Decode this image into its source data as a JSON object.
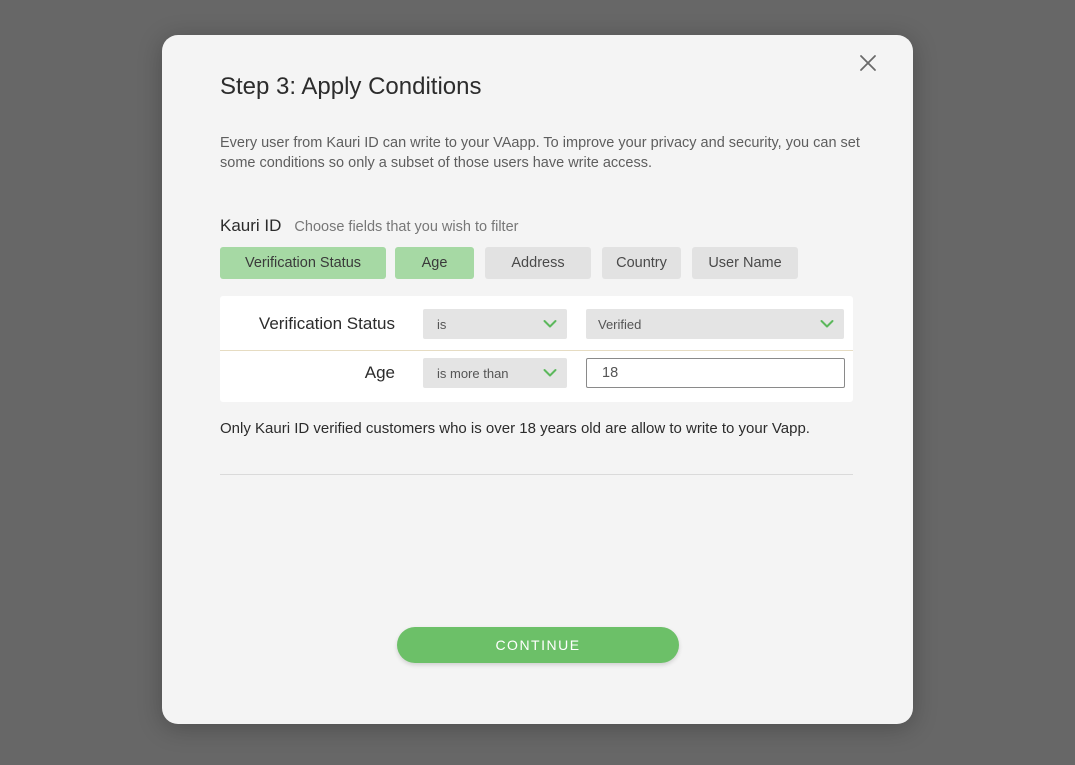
{
  "modal": {
    "title": "Step 3: Apply Conditions",
    "description": "Every user from Kauri ID can write to your VAapp. To improve your privacy and security, you can set some conditions so only a subset of those users have write access.",
    "close_icon": "close-icon"
  },
  "filter_section": {
    "title": "Kauri ID",
    "subtitle": "Choose fields that you wish to filter",
    "chips": [
      {
        "label": "Verification Status",
        "active": true
      },
      {
        "label": "Age",
        "active": true
      },
      {
        "label": "Address",
        "active": false
      },
      {
        "label": "Country",
        "active": false
      },
      {
        "label": "User Name",
        "active": false
      }
    ]
  },
  "conditions": [
    {
      "field": "Verification Status",
      "operator": "is",
      "value": "Verified",
      "value_type": "select"
    },
    {
      "field": "Age",
      "operator": "is more than",
      "value": "18",
      "value_type": "input"
    }
  ],
  "summary": "Only Kauri ID verified customers who is over 18 years old are allow to write to your Vapp.",
  "continue_label": "CONTINUE",
  "colors": {
    "overlay": "#676767",
    "modal_bg": "#f4f4f4",
    "chip_active": "#a6d9a4",
    "chip_inactive": "#e2e2e2",
    "accent_green": "#6cc068",
    "chevron_green": "#5cb85c"
  }
}
